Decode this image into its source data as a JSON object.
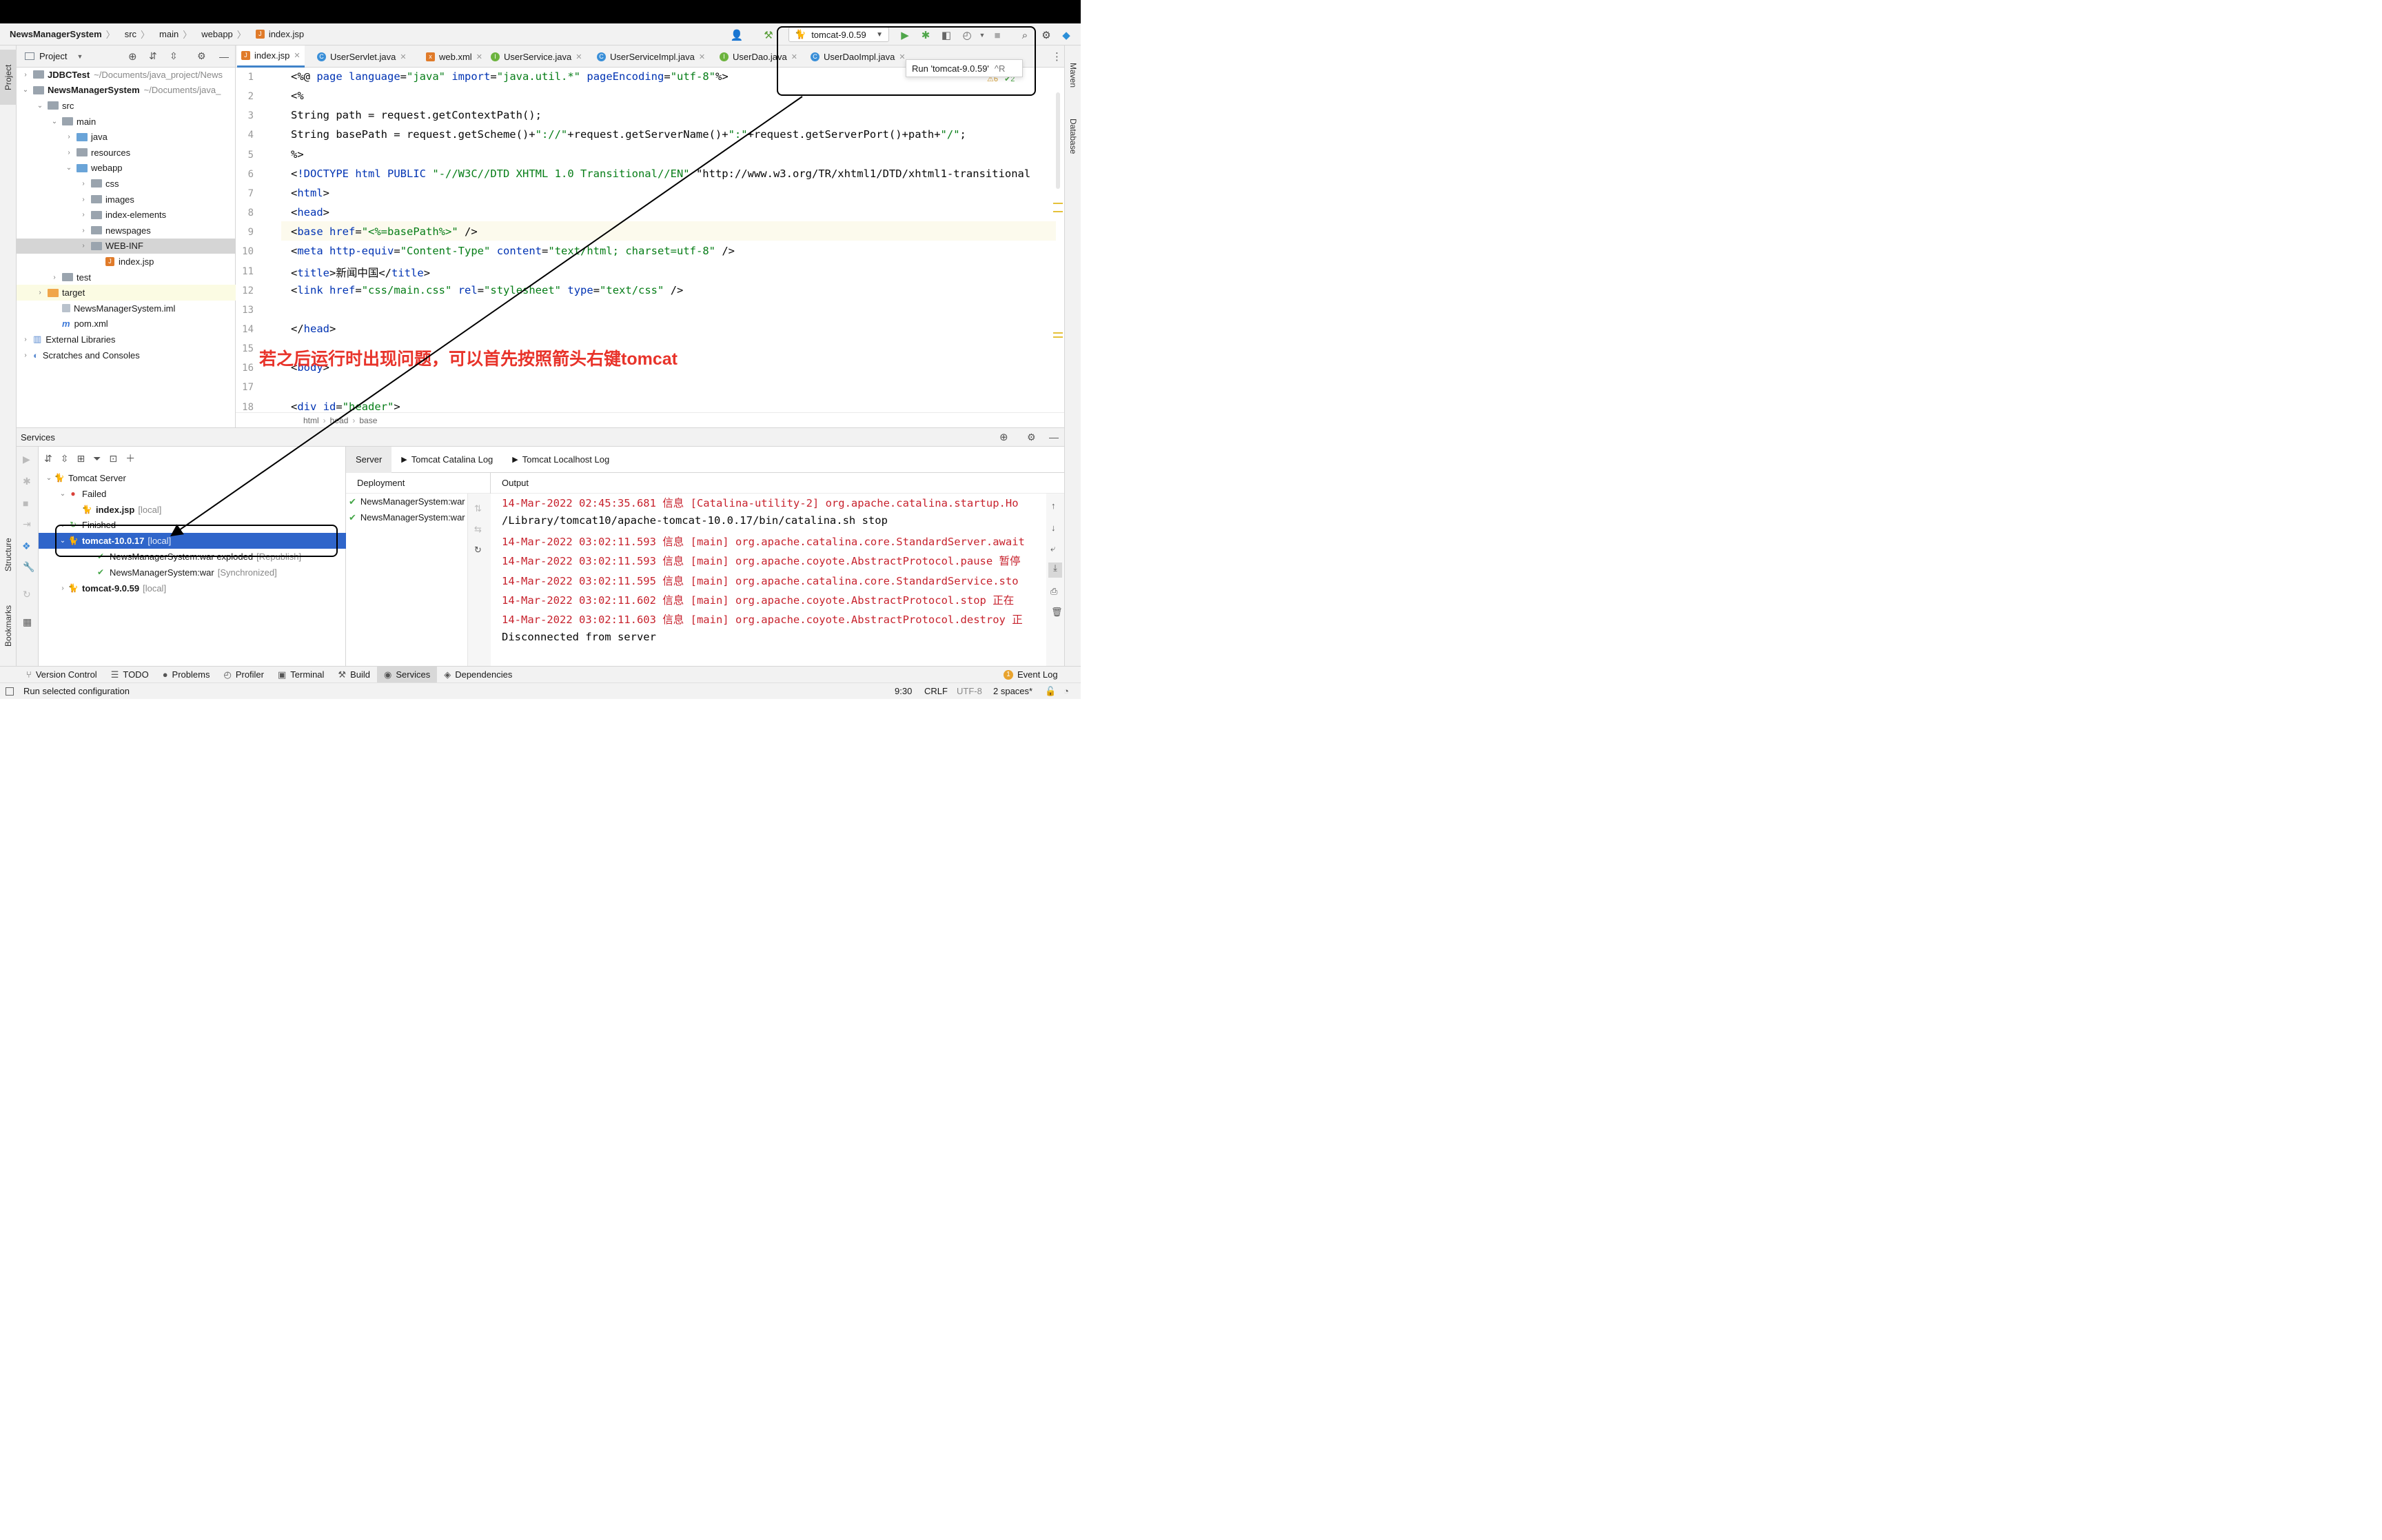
{
  "breadcrumb": [
    "NewsManagerSystem",
    "src",
    "main",
    "webapp",
    "index.jsp"
  ],
  "run_config": {
    "selected": "tomcat-9.0.59",
    "tooltip": "Run 'tomcat-9.0.59'",
    "tooltip_shortcut": "^R"
  },
  "project_panel": {
    "title": "Project",
    "tree": [
      {
        "label": "JDBCTest",
        "path": "~/Documents/java_project/News",
        "depth": 0,
        "arrow": "›",
        "icon": "fold-gray",
        "bold": true
      },
      {
        "label": "NewsManagerSystem",
        "path": "~/Documents/java_",
        "depth": 0,
        "arrow": "⌄",
        "icon": "fold-gray",
        "bold": true
      },
      {
        "label": "src",
        "depth": 1,
        "arrow": "⌄",
        "icon": "fold-gray"
      },
      {
        "label": "main",
        "depth": 2,
        "arrow": "⌄",
        "icon": "fold-gray"
      },
      {
        "label": "java",
        "depth": 3,
        "arrow": "›",
        "icon": "fold-blue"
      },
      {
        "label": "resources",
        "depth": 3,
        "arrow": "›",
        "icon": "fold-res"
      },
      {
        "label": "webapp",
        "depth": 3,
        "arrow": "⌄",
        "icon": "fold-blue"
      },
      {
        "label": "css",
        "depth": 4,
        "arrow": "›",
        "icon": "fold-gray"
      },
      {
        "label": "images",
        "depth": 4,
        "arrow": "›",
        "icon": "fold-gray"
      },
      {
        "label": "index-elements",
        "depth": 4,
        "arrow": "›",
        "icon": "fold-gray"
      },
      {
        "label": "newspages",
        "depth": 4,
        "arrow": "›",
        "icon": "fold-gray"
      },
      {
        "label": "WEB-INF",
        "depth": 4,
        "arrow": "›",
        "icon": "fold-gray",
        "selected": true
      },
      {
        "label": "index.jsp",
        "depth": 5,
        "arrow": "",
        "icon": "jsp"
      },
      {
        "label": "test",
        "depth": 2,
        "arrow": "›",
        "icon": "fold-gray"
      },
      {
        "label": "target",
        "depth": 1,
        "arrow": "›",
        "icon": "fold-orange",
        "highlight": true
      },
      {
        "label": "NewsManagerSystem.iml",
        "depth": 2,
        "arrow": "",
        "icon": "iml"
      },
      {
        "label": "pom.xml",
        "depth": 2,
        "arrow": "",
        "icon": "pom"
      },
      {
        "label": "External Libraries",
        "depth": 0,
        "arrow": "›",
        "icon": "lib"
      },
      {
        "label": "Scratches and Consoles",
        "depth": 0,
        "arrow": "›",
        "icon": "scratch"
      }
    ]
  },
  "editor_tabs": [
    {
      "label": "index.jsp",
      "type": "jsp",
      "active": true
    },
    {
      "label": "UserServlet.java",
      "type": "c"
    },
    {
      "label": "web.xml",
      "type": "x"
    },
    {
      "label": "UserService.java",
      "type": "i"
    },
    {
      "label": "UserServiceImpl.java",
      "type": "c"
    },
    {
      "label": "UserDao.java",
      "type": "i"
    },
    {
      "label": "UserDaoImpl.java",
      "type": "c"
    }
  ],
  "inspection": {
    "warnings": "6",
    "ok": "2"
  },
  "code_lines": [
    "<%@ page language=\"java\" import=\"java.util.*\" pageEncoding=\"utf-8\"%>",
    "<%",
    "String path = request.getContextPath();",
    "String basePath = request.getScheme()+\"://\"+request.getServerName()+\":\"+request.getServerPort()+path+\"/\";",
    "%>",
    "<!DOCTYPE html PUBLIC \"-//W3C//DTD XHTML 1.0 Transitional//EN\" \"http://www.w3.org/TR/xhtml1/DTD/xhtml1-transitional",
    "<html>",
    "<head>",
    "<base href=\"<%=basePath%>\" />",
    "<meta http-equiv=\"Content-Type\" content=\"text/html; charset=utf-8\" />",
    "<title>新闻中国</title>",
    "<link href=\"css/main.css\" rel=\"stylesheet\" type=\"text/css\" />",
    "",
    "</head>",
    "",
    "<body>",
    "",
    "<div id=\"header\">"
  ],
  "editor_breadcrumb": [
    "html",
    "head",
    "base"
  ],
  "annotation": "若之后运行时出现问题，可以首先按照箭头右键tomcat",
  "services": {
    "title": "Services",
    "tree": [
      {
        "label": "Tomcat Server",
        "depth": 0,
        "arrow": "⌄",
        "icon": "tomcat"
      },
      {
        "label": "Failed",
        "depth": 1,
        "arrow": "⌄",
        "icon": "err"
      },
      {
        "label": "index.jsp",
        "suffix": "[local]",
        "depth": 2,
        "arrow": "",
        "icon": "tomcat",
        "bold": true
      },
      {
        "label": "Finished",
        "depth": 1,
        "arrow": "⌄",
        "icon": "fin"
      },
      {
        "label": "tomcat-10.0.17",
        "suffix": "[local]",
        "depth": 1,
        "arrow": "⌄",
        "icon": "tomcat",
        "bold": true,
        "selected": true
      },
      {
        "label": "NewsManagerSystem:war exploded",
        "suffix": "[Republish]",
        "depth": 3,
        "arrow": "",
        "icon": "war",
        "strike": true
      },
      {
        "label": "NewsManagerSystem:war",
        "suffix": "[Synchronized]",
        "depth": 3,
        "arrow": "",
        "icon": "war"
      },
      {
        "label": "tomcat-9.0.59",
        "suffix": "[local]",
        "depth": 1,
        "arrow": "›",
        "icon": "tomcat",
        "bold": true
      }
    ],
    "tabs": [
      "Server",
      "Tomcat Catalina Log",
      "Tomcat Localhost Log"
    ],
    "deployment_header": "Deployment",
    "deployments": [
      "NewsManagerSystem:war",
      "NewsManagerSystem:war"
    ],
    "output_header": "Output",
    "output": [
      {
        "text": "14-Mar-2022 02:45:35.681 信息 [Catalina-utility-2] org.apache.catalina.startup.Ho",
        "color": "red"
      },
      {
        "text": "/Library/tomcat10/apache-tomcat-10.0.17/bin/catalina.sh stop",
        "color": "black"
      },
      {
        "text": "14-Mar-2022 03:02:11.593 信息 [main] org.apache.catalina.core.StandardServer.await",
        "color": "red"
      },
      {
        "text": "14-Mar-2022 03:02:11.593 信息 [main] org.apache.coyote.AbstractProtocol.pause 暂停",
        "color": "red"
      },
      {
        "text": "14-Mar-2022 03:02:11.595 信息 [main] org.apache.catalina.core.StandardService.sto",
        "color": "red"
      },
      {
        "text": "14-Mar-2022 03:02:11.602 信息 [main] org.apache.coyote.AbstractProtocol.stop 正在",
        "color": "red"
      },
      {
        "text": "14-Mar-2022 03:02:11.603 信息 [main] org.apache.coyote.AbstractProtocol.destroy 正",
        "color": "red"
      },
      {
        "text": "Disconnected from server",
        "color": "black"
      }
    ]
  },
  "tool_windows": {
    "left": [
      "Project",
      "Structure",
      "Bookmarks"
    ],
    "right": [
      "Maven",
      "Database"
    ],
    "bottom": [
      "Version Control",
      "TODO",
      "Problems",
      "Profiler",
      "Terminal",
      "Build",
      "Services",
      "Dependencies"
    ],
    "bottom_active": "Services",
    "event_log": "Event Log",
    "event_log_count": "1"
  },
  "status_bar": {
    "message": "Run selected configuration",
    "position": "9:30",
    "line_sep": "CRLF",
    "encoding": "UTF-8",
    "indent": "2 spaces*"
  }
}
